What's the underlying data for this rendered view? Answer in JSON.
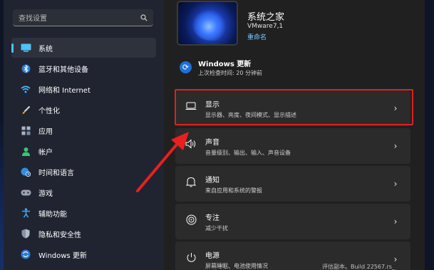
{
  "search": {
    "placeholder": "查找设置"
  },
  "sidebar": {
    "items": [
      {
        "label": "系统",
        "icon": "monitor-icon",
        "active": true
      },
      {
        "label": "蓝牙和其他设备",
        "icon": "bluetooth-icon"
      },
      {
        "label": "网络和 Internet",
        "icon": "wifi-icon"
      },
      {
        "label": "个性化",
        "icon": "brush-icon"
      },
      {
        "label": "应用",
        "icon": "apps-icon"
      },
      {
        "label": "帐户",
        "icon": "person-icon"
      },
      {
        "label": "时间和语言",
        "icon": "globe-clock-icon"
      },
      {
        "label": "游戏",
        "icon": "gamepad-icon"
      },
      {
        "label": "辅助功能",
        "icon": "accessibility-icon"
      },
      {
        "label": "隐私和安全性",
        "icon": "shield-icon"
      },
      {
        "label": "Windows 更新",
        "icon": "update-icon"
      }
    ]
  },
  "device": {
    "name": "系统之家",
    "model": "VMware7,1",
    "rename": "重命名"
  },
  "windows_update": {
    "title": "Windows 更新",
    "subtitle": "上次检查时间: 20 分钟前"
  },
  "cards": [
    {
      "title": "显示",
      "desc": "显示器、亮度、夜间模式、显示描述",
      "icon": "display-icon",
      "highlighted": true
    },
    {
      "title": "声音",
      "desc": "音量级别、输出、输入、声音设备",
      "icon": "speaker-icon"
    },
    {
      "title": "通知",
      "desc": "来自应用和系统的警报",
      "icon": "bell-icon"
    },
    {
      "title": "专注",
      "desc": "减少干扰",
      "icon": "focus-icon"
    },
    {
      "title": "电源",
      "desc": "屏幕睡眠、电池使用情况",
      "icon": "power-icon"
    }
  ],
  "watermark": "评估副本。Build 22567.rs_"
}
